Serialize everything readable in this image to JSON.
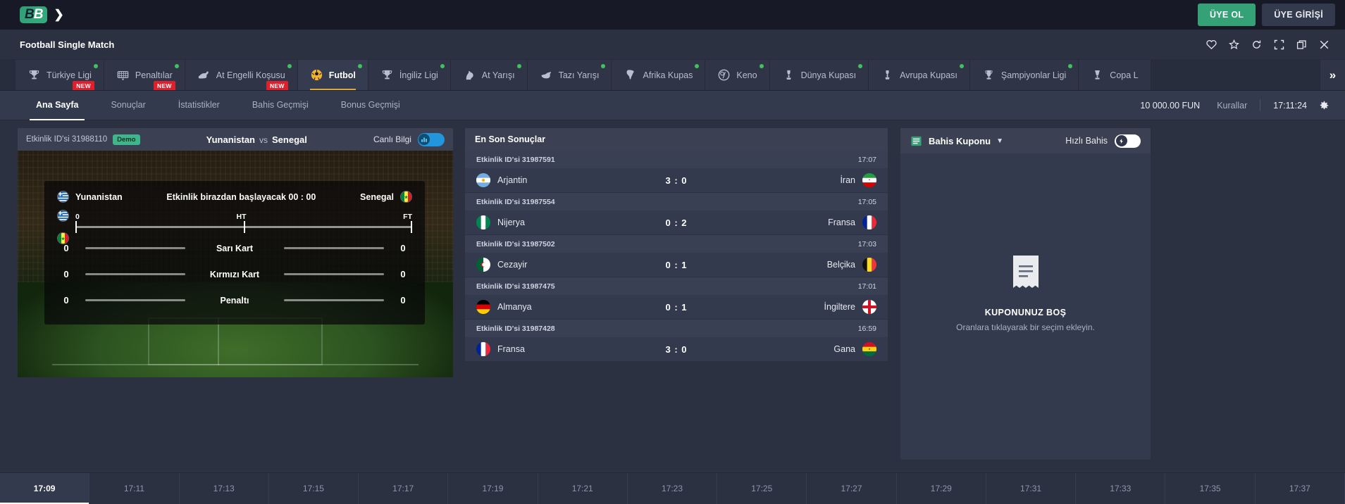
{
  "topbar": {
    "logo_text_1": "B",
    "logo_text_2": "B",
    "signup_label": "ÜYE OL",
    "login_label": "ÜYE GİRİŞİ",
    "accent_green": "#35a176"
  },
  "title_row": {
    "page_title": "Football Single Match",
    "window_icons": [
      "heart-icon",
      "star-icon",
      "refresh-icon",
      "fullscreen-icon",
      "popout-icon",
      "close-icon"
    ]
  },
  "sport_tabs": [
    {
      "label": "Türkiye Ligi",
      "icon": "trophy-icon",
      "dot": true,
      "new": true,
      "active": false
    },
    {
      "label": "Penaltılar",
      "icon": "goal-net-icon",
      "dot": true,
      "new": true,
      "active": false
    },
    {
      "label": "At Engelli Koşusu",
      "icon": "horse-jump-icon",
      "dot": true,
      "new": true,
      "active": false
    },
    {
      "label": "Futbol",
      "icon": "football-icon",
      "dot": true,
      "new": false,
      "active": true
    },
    {
      "label": "İngiliz Ligi",
      "icon": "trophy-icon",
      "dot": true,
      "new": false,
      "active": false
    },
    {
      "label": "At Yarışı",
      "icon": "horse-head-icon",
      "dot": true,
      "new": false,
      "active": false
    },
    {
      "label": "Tazı Yarışı",
      "icon": "greyhound-icon",
      "dot": true,
      "new": false,
      "active": false
    },
    {
      "label": "Afrika Kupas",
      "icon": "africa-cup-icon",
      "dot": true,
      "new": false,
      "active": false
    },
    {
      "label": "Keno",
      "icon": "keno-icon",
      "dot": true,
      "new": false,
      "active": false
    },
    {
      "label": "Dünya Kupası",
      "icon": "world-cup-icon",
      "dot": true,
      "new": false,
      "active": false
    },
    {
      "label": "Avrupa Kupası",
      "icon": "euro-cup-icon",
      "dot": true,
      "new": false,
      "active": false
    },
    {
      "label": "Şampiyonlar Ligi",
      "icon": "champions-cup-icon",
      "dot": true,
      "new": false,
      "active": false
    },
    {
      "label": "Copa L",
      "icon": "copa-cup-icon",
      "dot": false,
      "new": false,
      "active": false
    }
  ],
  "tabs_more_label": "»",
  "subnav": {
    "items": [
      {
        "label": "Ana Sayfa",
        "active": true
      },
      {
        "label": "Sonuçlar",
        "active": false
      },
      {
        "label": "İstatistikler",
        "active": false
      },
      {
        "label": "Bahis Geçmişi",
        "active": false
      },
      {
        "label": "Bonus Geçmişi",
        "active": false
      }
    ],
    "balance": "10 000.00 FUN",
    "rules_label": "Kurallar",
    "clock": "17:11:24",
    "settings_icon": "gear-icon"
  },
  "match_header": {
    "event_id_label": "Etkinlik ID'si 31988110",
    "demo_badge": "Demo",
    "home_team": "Yunanistan",
    "vs": "vs",
    "away_team": "Senegal",
    "live_info_label": "Canlı Bilgi",
    "live_info_on": true
  },
  "match_overlay": {
    "home_team": "Yunanistan",
    "away_team": "Senegal",
    "status_text": "Etkinlik birazdan başlayacak 00 : 00",
    "timeline": {
      "start_label": "0",
      "half_label": "HT",
      "full_label": "FT"
    },
    "stats": [
      {
        "label": "Sarı Kart",
        "home": "0",
        "away": "0"
      },
      {
        "label": "Kırmızı Kart",
        "home": "0",
        "away": "0"
      },
      {
        "label": "Penaltı",
        "home": "0",
        "away": "0"
      }
    ]
  },
  "timeline_strip": {
    "times": [
      "17:09",
      "17:11",
      "17:13",
      "17:15",
      "17:17",
      "17:19",
      "17:21",
      "17:23",
      "17:25",
      "17:27",
      "17:29",
      "17:31",
      "17:33",
      "17:35",
      "17:37"
    ],
    "active_index": 0
  },
  "results": {
    "title": "En Son Sonuçlar",
    "items": [
      {
        "event_id": "Etkinlik ID'si 31987591",
        "time": "17:07",
        "home": "Arjantin",
        "away": "İran",
        "score": "3 : 0",
        "home_flag": "argentina-flag",
        "away_flag": "iran-flag"
      },
      {
        "event_id": "Etkinlik ID'si 31987554",
        "time": "17:05",
        "home": "Nijerya",
        "away": "Fransa",
        "score": "0 : 2",
        "home_flag": "nigeria-flag",
        "away_flag": "france-flag"
      },
      {
        "event_id": "Etkinlik ID'si 31987502",
        "time": "17:03",
        "home": "Cezayir",
        "away": "Belçika",
        "score": "0 : 1",
        "home_flag": "algeria-flag",
        "away_flag": "belgium-flag"
      },
      {
        "event_id": "Etkinlik ID'si 31987475",
        "time": "17:01",
        "home": "Almanya",
        "away": "İngiltere",
        "score": "0 : 1",
        "home_flag": "germany-flag",
        "away_flag": "england-flag"
      },
      {
        "event_id": "Etkinlik ID'si 31987428",
        "time": "16:59",
        "home": "Fransa",
        "away": "Gana",
        "score": "3 : 0",
        "home_flag": "france-flag",
        "away_flag": "ghana-flag"
      }
    ]
  },
  "bet_slip": {
    "title": "Bahis Kuponu",
    "quick_bet_label": "Hızlı Bahis",
    "quick_bet_on": false,
    "empty_title": "KUPONUNUZ BOŞ",
    "empty_subtitle": "Oranlara tıklayarak bir seçim ekleyin.",
    "icon": "receipt-icon"
  }
}
